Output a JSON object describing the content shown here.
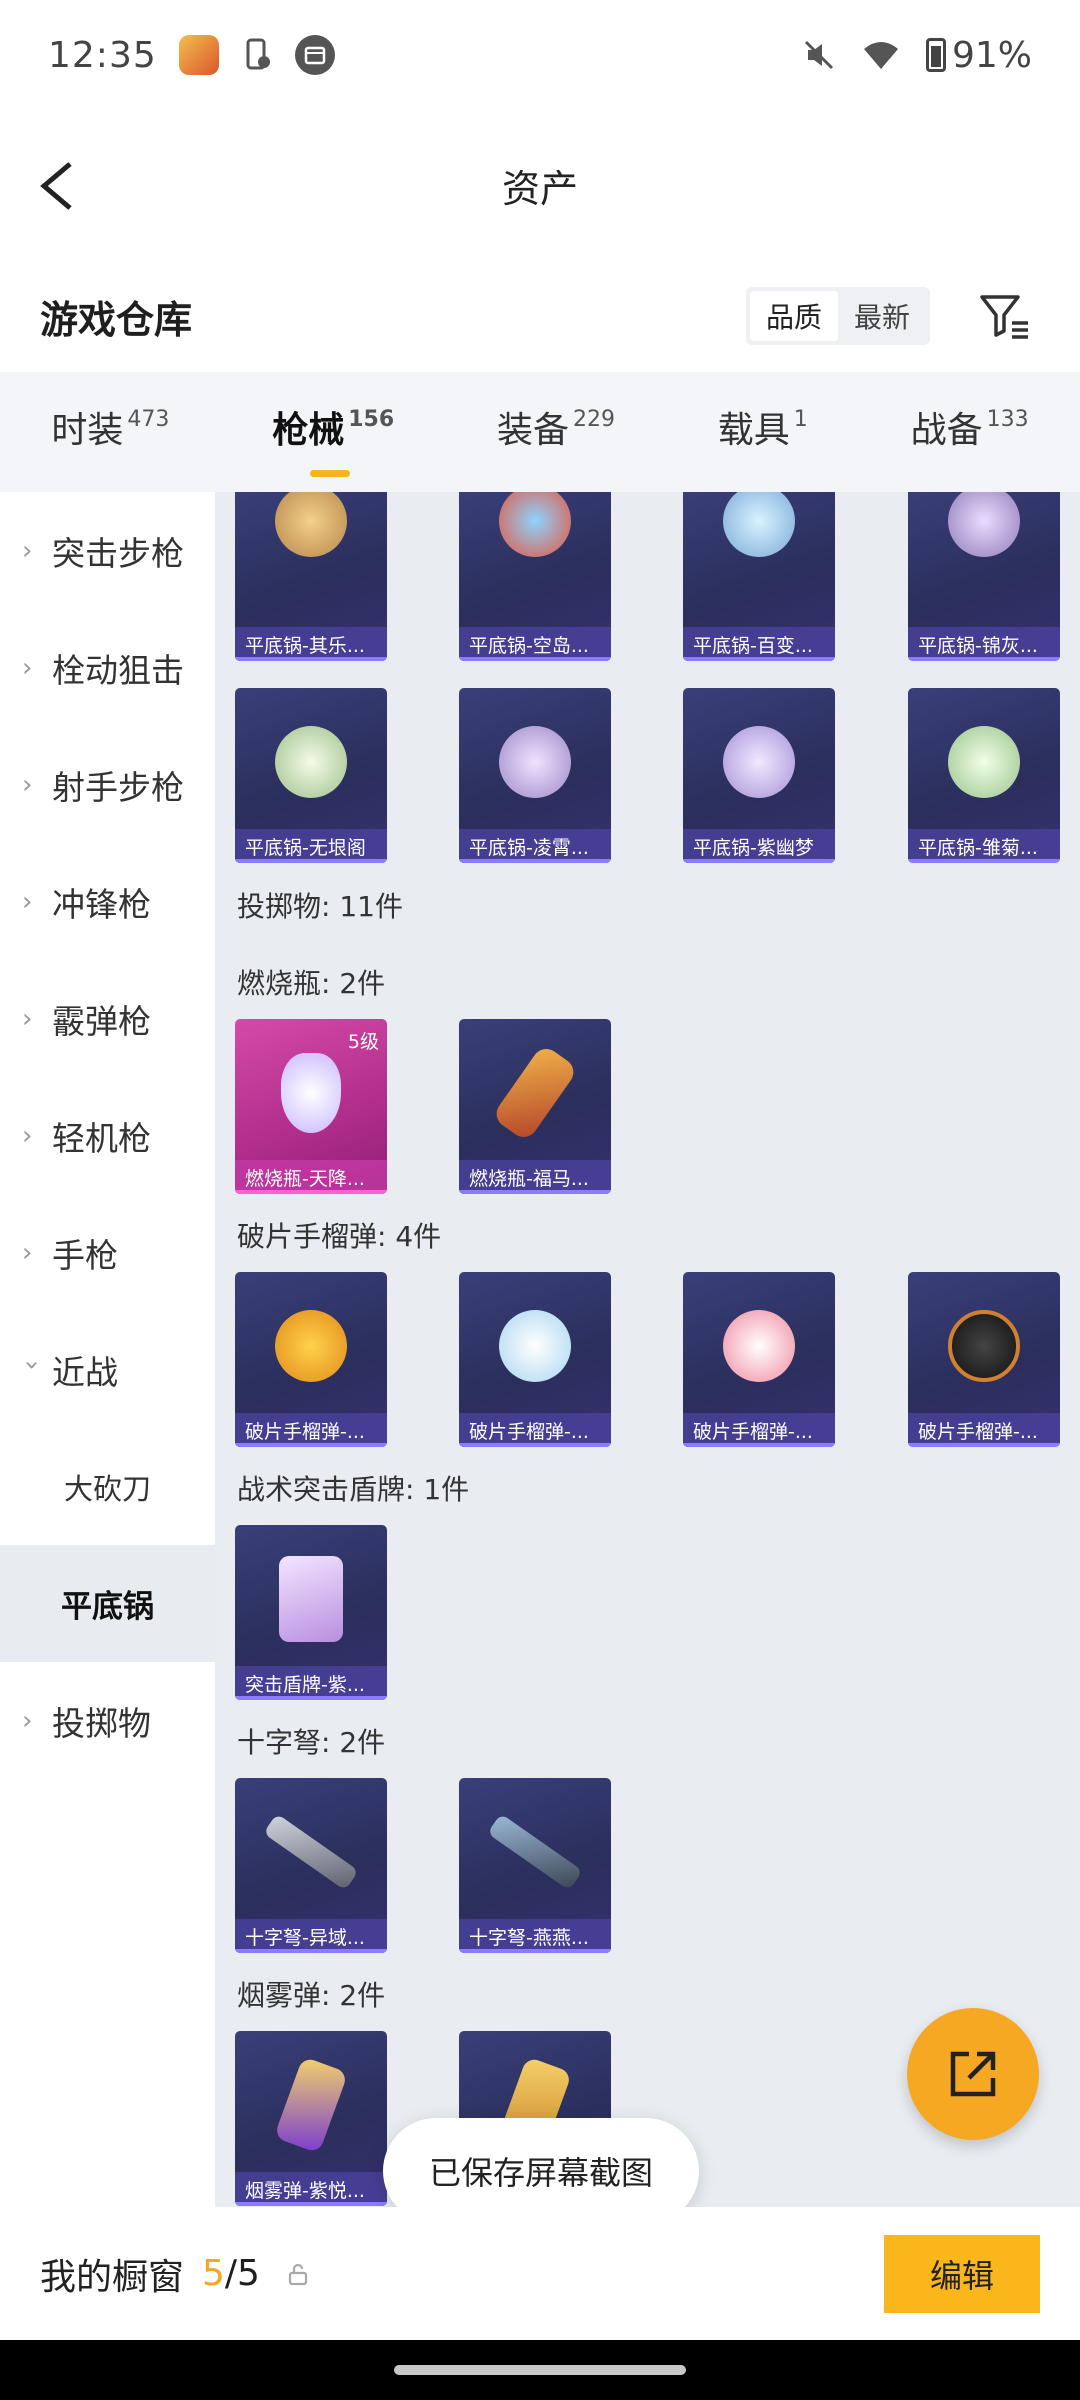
{
  "status_bar": {
    "time": "12:35",
    "battery": "91%"
  },
  "header": {
    "title": "资产"
  },
  "section": {
    "title": "游戏仓库",
    "sort_options": [
      "品质",
      "最新"
    ]
  },
  "tabs": [
    {
      "label": "时装",
      "count": "473"
    },
    {
      "label": "枪械",
      "count": "156"
    },
    {
      "label": "装备",
      "count": "229"
    },
    {
      "label": "载具",
      "count": "1"
    },
    {
      "label": "战备",
      "count": "133"
    }
  ],
  "sidebar": {
    "items": [
      "突击步枪",
      "栓动狙击",
      "射手步枪",
      "冲锋枪",
      "霰弹枪",
      "轻机枪",
      "手枪",
      "近战",
      "大砍刀",
      "平底锅",
      "投掷物"
    ]
  },
  "content": {
    "row1": [
      "平底锅-其乐...",
      "平底锅-空岛...",
      "平底锅-百变...",
      "平底锅-锦灰..."
    ],
    "row2": [
      "平底锅-无垠阁",
      "平底锅-凌霄...",
      "平底锅-紫幽梦",
      "平底锅-雏菊..."
    ],
    "throwables_label": "投掷物: 11件",
    "molotov_label": "燃烧瓶: 2件",
    "molotov": [
      "燃烧瓶-天降...",
      "燃烧瓶-福马..."
    ],
    "molotov_level": "5级",
    "frag_label": "破片手榴弹: 4件",
    "frag": [
      "破片手榴弹-...",
      "破片手榴弹-...",
      "破片手榴弹-...",
      "破片手榴弹-..."
    ],
    "shield_label": "战术突击盾牌: 1件",
    "shield": [
      "突击盾牌-紫..."
    ],
    "crossbow_label": "十字弩: 2件",
    "crossbow": [
      "十字弩-异域...",
      "十字弩-燕燕..."
    ],
    "smoke_label": "烟雾弹: 2件",
    "smoke": [
      "烟雾弹-紫悦..."
    ]
  },
  "toast": "已保存屏幕截图",
  "bottom": {
    "label": "我的橱窗",
    "current": "5",
    "sep_total": "/5",
    "edit": "编辑"
  },
  "colors": {
    "accent": "#f8b320",
    "card_bg": "#2f3365",
    "pink_card": "#c23a98"
  }
}
